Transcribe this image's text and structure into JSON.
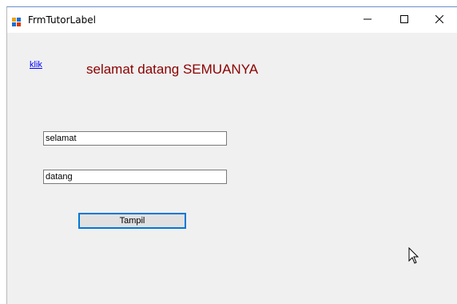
{
  "window": {
    "title": "FrmTutorLabel"
  },
  "form": {
    "link_text": "klik",
    "label_text": "selamat datang SEMUANYA",
    "textbox1_value": "selamat",
    "textbox2_value": "datang",
    "button_label": "Tampil"
  },
  "colors": {
    "label": "#8b0000",
    "link": "#0000ff",
    "button_border": "#0078d7",
    "form_background": "#f0f0f0"
  },
  "icons": {
    "app": "winforms-app-icon",
    "minimize": "minimize-icon",
    "maximize": "maximize-icon",
    "close": "close-icon",
    "cursor": "mouse-pointer-icon"
  }
}
